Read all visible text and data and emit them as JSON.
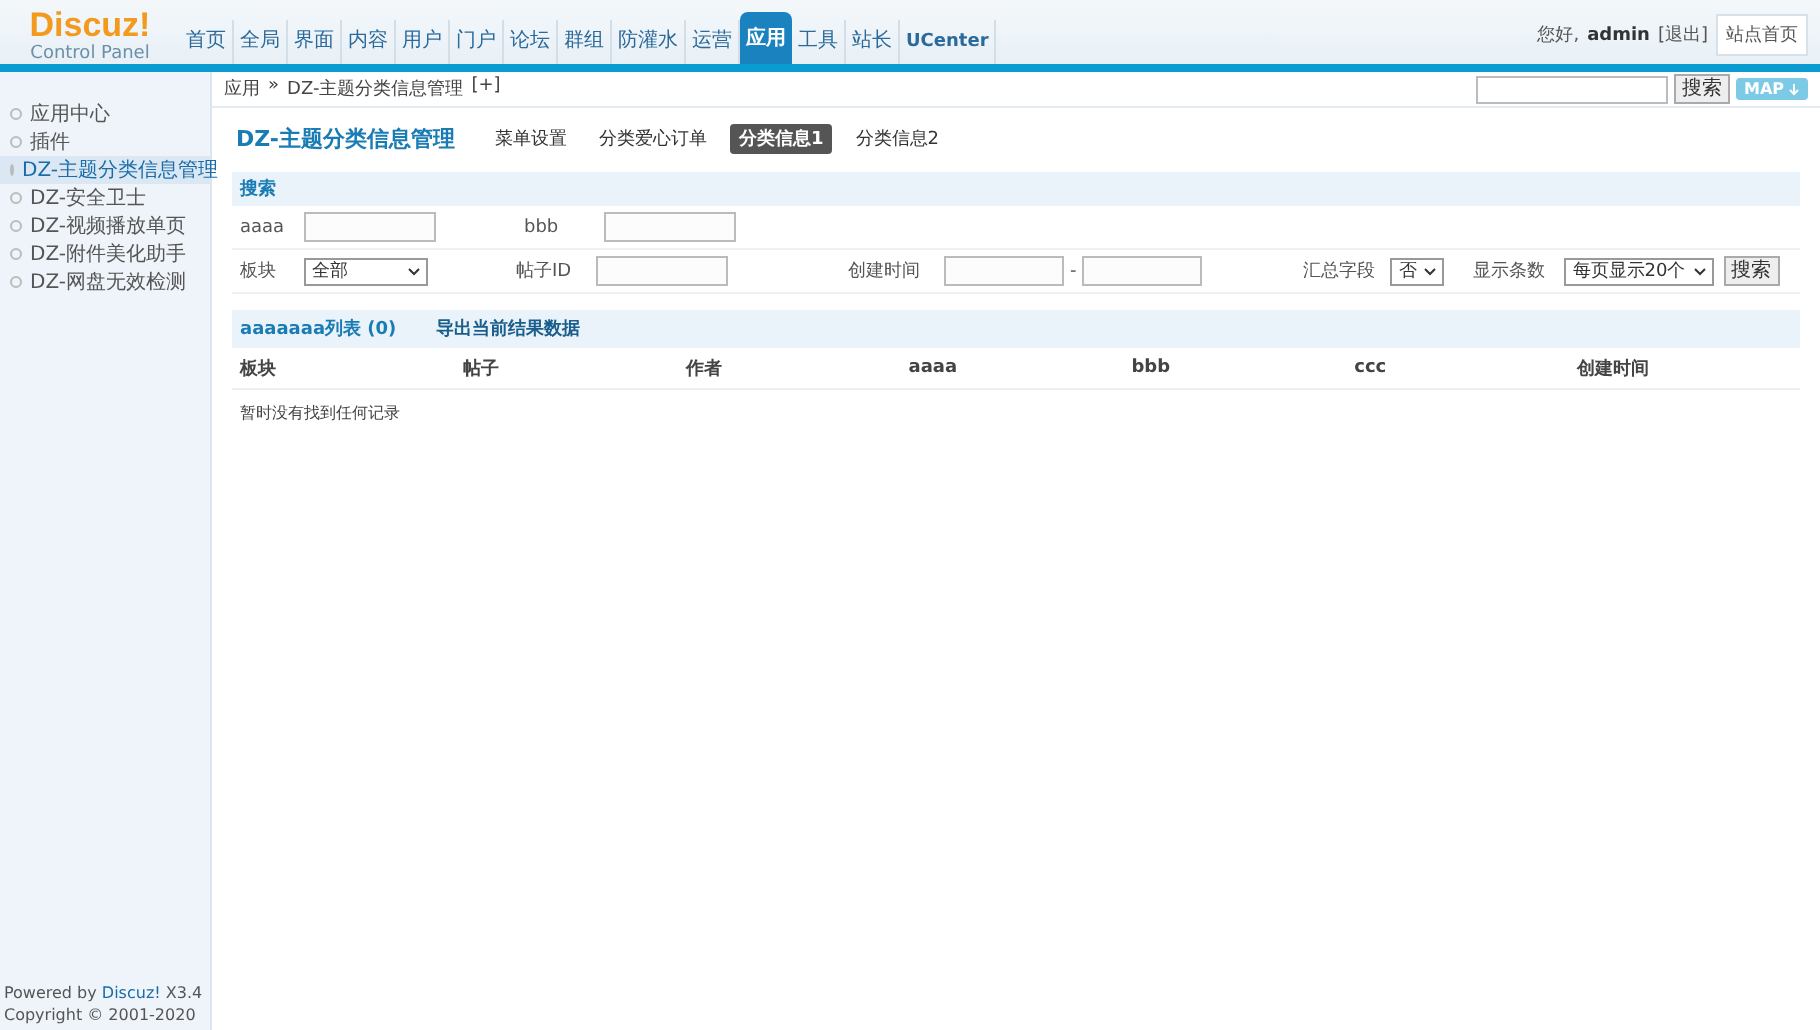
{
  "logo": {
    "name": "Discuz!",
    "subtitle": "Control Panel"
  },
  "nav": [
    {
      "label": "首页",
      "selected": false
    },
    {
      "label": "全局",
      "selected": false
    },
    {
      "label": "界面",
      "selected": false
    },
    {
      "label": "内容",
      "selected": false
    },
    {
      "label": "用户",
      "selected": false
    },
    {
      "label": "门户",
      "selected": false
    },
    {
      "label": "论坛",
      "selected": false
    },
    {
      "label": "群组",
      "selected": false
    },
    {
      "label": "防灌水",
      "selected": false
    },
    {
      "label": "运营",
      "selected": false
    },
    {
      "label": "应用",
      "selected": true
    },
    {
      "label": "工具",
      "selected": false
    },
    {
      "label": "站长",
      "selected": false
    },
    {
      "label": "UCenter",
      "selected": false
    }
  ],
  "user": {
    "greeting": "您好,",
    "name": "admin",
    "logout": "[退出]",
    "home": "站点首页"
  },
  "breadcrumb": {
    "root": "应用",
    "separator": "»",
    "current": "DZ-主题分类信息管理",
    "add": "[+]"
  },
  "topsearch": {
    "button": "搜索",
    "map": "MAP"
  },
  "sidebar": {
    "items": [
      {
        "label": "应用中心",
        "selected": false
      },
      {
        "label": "插件",
        "selected": false
      },
      {
        "label": "DZ-主题分类信息管理",
        "selected": true
      },
      {
        "label": "DZ-安全卫士",
        "selected": false
      },
      {
        "label": "DZ-视频播放单页",
        "selected": false
      },
      {
        "label": "DZ-附件美化助手",
        "selected": false
      },
      {
        "label": "DZ-网盘无效检测",
        "selected": false
      }
    ],
    "footer": {
      "powered": "Powered by",
      "brand": "Discuz!",
      "version": "X3.4",
      "copyright": "Copyright © 2001-2020"
    }
  },
  "page_title": "DZ-主题分类信息管理",
  "tabs": [
    {
      "label": "菜单设置",
      "selected": false
    },
    {
      "label": "分类爱心订单",
      "selected": false
    },
    {
      "label": "分类信息1",
      "selected": true
    },
    {
      "label": "分类信息2",
      "selected": false
    }
  ],
  "search_section": {
    "title": "搜索",
    "row1": [
      {
        "label": "aaaa"
      },
      {
        "label": "bbb"
      }
    ],
    "forum": {
      "label": "板块",
      "value": "全部"
    },
    "post_id": {
      "label": "帖子ID"
    },
    "created": {
      "label": "创建时间",
      "separator": "-"
    },
    "summary": {
      "label": "汇总字段",
      "value": "否"
    },
    "count": {
      "label": "显示条数",
      "value": "每页显示20个"
    },
    "button": "搜索"
  },
  "list": {
    "title": "aaaaaaa列表 (0)",
    "export": "导出当前结果数据",
    "columns": [
      "板块",
      "帖子",
      "作者",
      "aaaa",
      "bbb",
      "ccc",
      "创建时间"
    ],
    "empty": "暂时没有找到任何记录"
  }
}
